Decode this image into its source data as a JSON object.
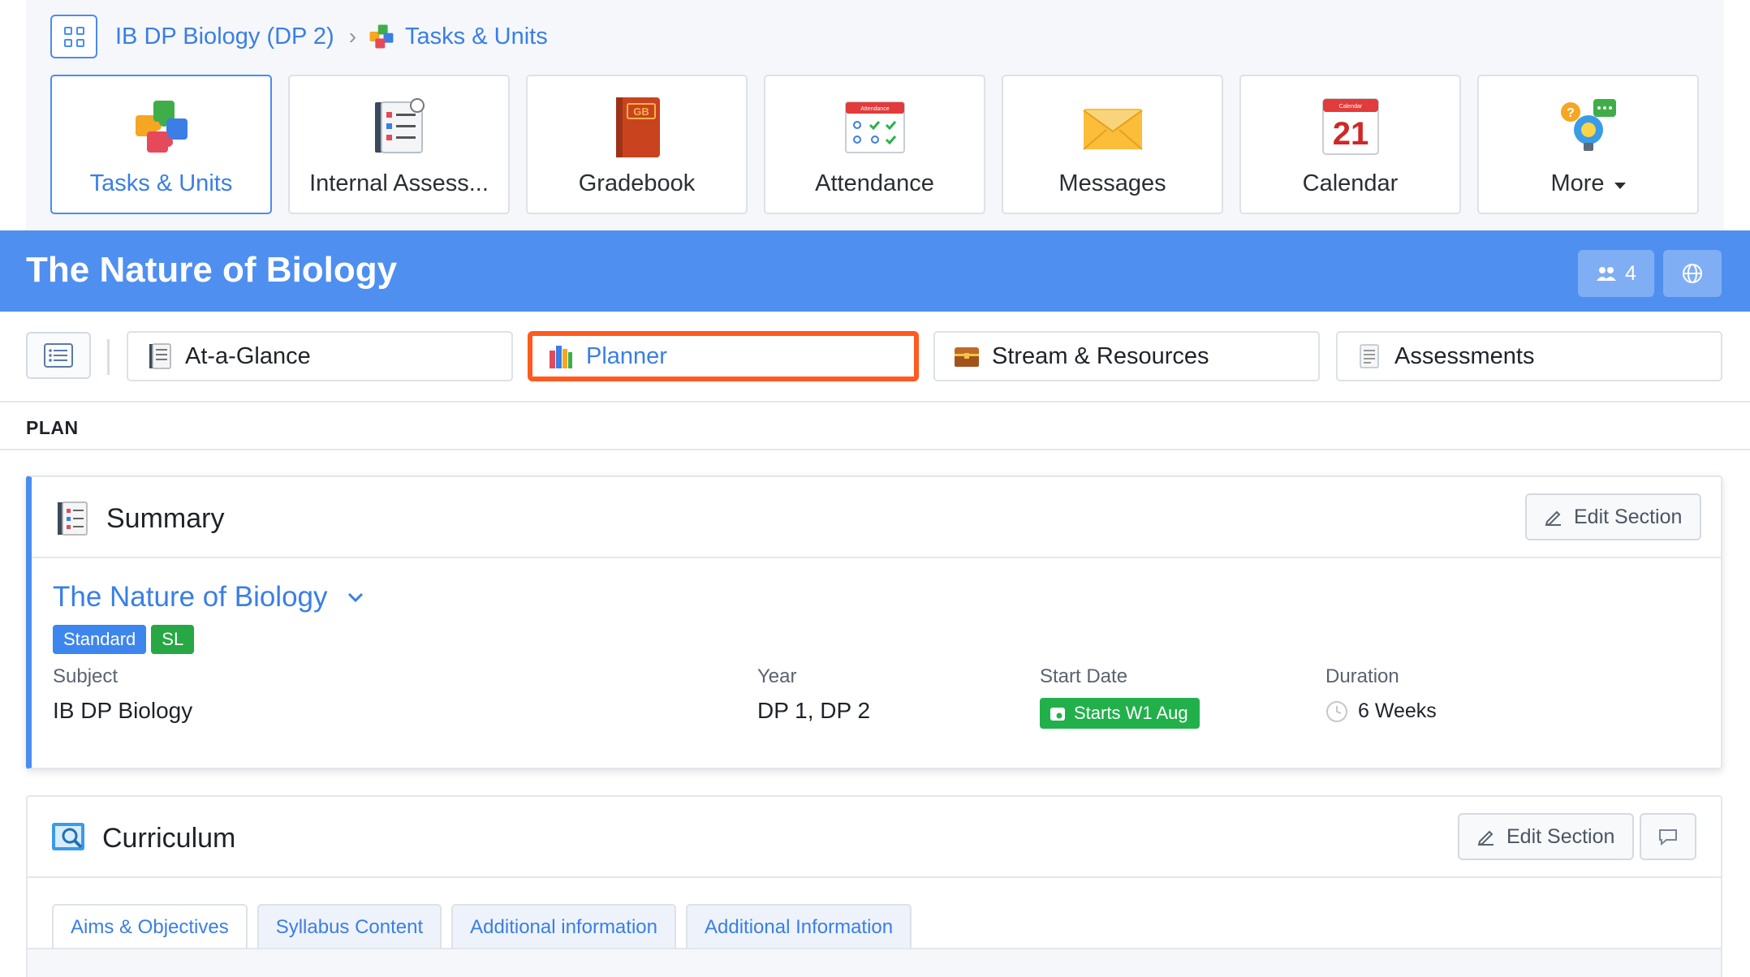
{
  "breadcrumb": {
    "course": "IB DP Biology (DP 2)",
    "current": "Tasks & Units"
  },
  "apps": [
    {
      "label": "Tasks & Units",
      "icon": "puzzle-icon",
      "active": true
    },
    {
      "label": "Internal Assess...",
      "icon": "checklist-icon"
    },
    {
      "label": "Gradebook",
      "icon": "gradebook-icon",
      "badge": "GB"
    },
    {
      "label": "Attendance",
      "icon": "attendance-icon",
      "badge": "Attendance"
    },
    {
      "label": "Messages",
      "icon": "envelope-icon"
    },
    {
      "label": "Calendar",
      "icon": "calendar-icon",
      "badge": "Calendar",
      "day": "21"
    },
    {
      "label": "More",
      "icon": "lightbulb-chat-icon"
    }
  ],
  "header": {
    "title": "The Nature of Biology",
    "members_count": "4",
    "accent": "#4f8ff0"
  },
  "tabs": [
    {
      "label": "At-a-Glance",
      "icon": "notebook-icon"
    },
    {
      "label": "Planner",
      "icon": "books-icon",
      "highlighted": true
    },
    {
      "label": "Stream & Resources",
      "icon": "chest-icon"
    },
    {
      "label": "Assessments",
      "icon": "document-icon"
    }
  ],
  "section_label": "PLAN",
  "summary": {
    "title": "Summary",
    "edit_label": "Edit Section",
    "unit_title": "The Nature of Biology",
    "badges": [
      "Standard",
      "SL"
    ],
    "fields": {
      "subject_label": "Subject",
      "subject_value": "IB DP Biology",
      "year_label": "Year",
      "year_value": "DP 1, DP 2",
      "start_label": "Start Date",
      "start_value": "Starts W1 Aug",
      "duration_label": "Duration",
      "duration_value": "6 Weeks"
    }
  },
  "curriculum": {
    "title": "Curriculum",
    "edit_label": "Edit Section",
    "tabs": [
      "Aims & Objectives",
      "Syllabus Content",
      "Additional information",
      "Additional Information"
    ]
  },
  "colors": {
    "link": "#3a7ee6",
    "highlight": "#ff5a1f",
    "green": "#28a745"
  }
}
